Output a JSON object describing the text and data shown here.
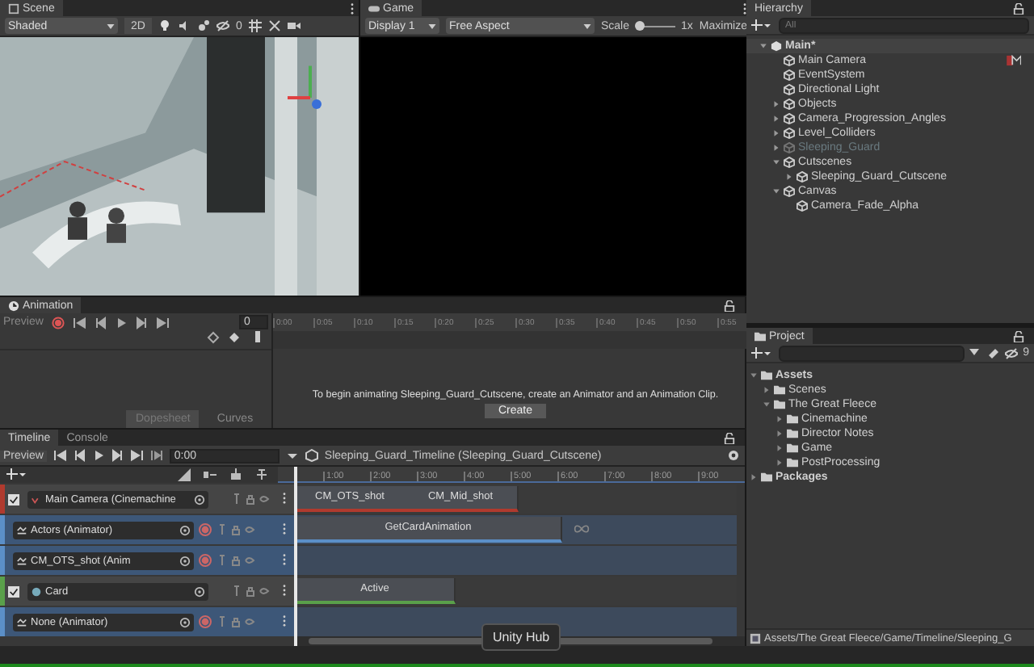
{
  "scene": {
    "tab": "Scene",
    "shading": "Shaded",
    "mode_2d": "2D",
    "hidden_count": "0"
  },
  "game": {
    "tab": "Game",
    "display": "Display 1",
    "aspect": "Free Aspect",
    "scale": {
      "label": "Scale",
      "level": 0.1,
      "reading": "1x"
    },
    "maximize": "Maximize"
  },
  "animation": {
    "tab": "Animation",
    "preview": "Preview",
    "frame": "0",
    "ticks": [
      "0:00",
      "0:05",
      "0:10",
      "0:15",
      "0:20",
      "0:25",
      "0:30",
      "0:35",
      "0:40",
      "0:45",
      "0:50",
      "0:55"
    ],
    "message": "To begin animating Sleeping_Guard_Cutscene, create an Animator and an Animation Clip.",
    "create_button": "Create",
    "views": [
      {
        "label": "Dopesheet",
        "selected": true
      },
      {
        "label": "Curves",
        "selected": false
      }
    ]
  },
  "timeline": {
    "tabs": [
      {
        "label": "Timeline",
        "selected": true
      },
      {
        "label": "Console",
        "selected": false
      }
    ],
    "preview": "Preview",
    "time": "0:00",
    "asset": "Sleeping_Guard_Timeline (Sleeping_Guard_Cutscene)",
    "ticks": [
      "1:00",
      "2:00",
      "3:00",
      "4:00",
      "5:00",
      "6:00",
      "7:00",
      "8:00",
      "9:00"
    ],
    "tracks": [
      {
        "kind": "cinemachine",
        "name": "Main Camera (Cinemachine",
        "color": "#b03a2e",
        "selected": false,
        "checked": true,
        "clips": [
          {
            "label": "CM_OTS_shot"
          },
          {
            "label": "CM_Mid_shot"
          }
        ]
      },
      {
        "kind": "animator",
        "name": "Actors (Animator)",
        "color": "#5b8fc7",
        "selected": true,
        "checked": false,
        "clips": [
          {
            "label": "GetCardAnimation"
          }
        ]
      },
      {
        "kind": "animator",
        "name": "CM_OTS_shot (Anim",
        "color": "#5b8fc7",
        "selected": true,
        "checked": false
      },
      {
        "kind": "activation",
        "name": "Card",
        "color": "#5aa04a",
        "selected": false,
        "checked": true,
        "clips": [
          {
            "label": "Active"
          }
        ]
      },
      {
        "kind": "animator",
        "name": "None (Animator)",
        "color": "#5b8fc7",
        "selected": true,
        "checked": false
      }
    ]
  },
  "hierarchy": {
    "title": "Hierarchy",
    "placeholder": "All",
    "items": [
      {
        "name": "Main*",
        "kind": "scene",
        "expanded": true,
        "disabled": false,
        "children": [
          {
            "name": "Main Camera",
            "kind": "object",
            "disabled": false
          },
          {
            "name": "EventSystem",
            "kind": "object",
            "disabled": false
          },
          {
            "name": "Directional Light",
            "kind": "object",
            "disabled": false
          },
          {
            "name": "Objects",
            "kind": "object",
            "expanded": false,
            "disabled": false
          },
          {
            "name": "Camera_Progression_Angles",
            "kind": "object",
            "expanded": false,
            "disabled": false
          },
          {
            "name": "Level_Colliders",
            "kind": "object",
            "expanded": false,
            "disabled": false
          },
          {
            "name": "Sleeping_Guard",
            "kind": "object",
            "expanded": false,
            "disabled": true
          },
          {
            "name": "Cutscenes",
            "kind": "object",
            "expanded": true,
            "disabled": false,
            "children": [
              {
                "name": "Sleeping_Guard_Cutscene",
                "kind": "object",
                "expanded": false,
                "disabled": false
              }
            ]
          },
          {
            "name": "Canvas",
            "kind": "object",
            "expanded": true,
            "disabled": false,
            "children": [
              {
                "name": "Camera_Fade_Alpha",
                "kind": "object",
                "disabled": false
              }
            ]
          }
        ]
      }
    ]
  },
  "project": {
    "title": "Project",
    "hidden_count": "9",
    "items": [
      {
        "name": "Assets",
        "expanded": true,
        "children": [
          {
            "name": "Scenes",
            "expanded": false
          },
          {
            "name": "The Great Fleece",
            "expanded": true,
            "children": [
              {
                "name": "Cinemachine",
                "expanded": false
              },
              {
                "name": "Director Notes",
                "expanded": false
              },
              {
                "name": "Game",
                "expanded": false
              },
              {
                "name": "PostProcessing",
                "expanded": false
              }
            ]
          }
        ]
      },
      {
        "name": "Packages",
        "expanded": false
      }
    ],
    "path": "Assets/The Great Fleece/Game/Timeline/Sleeping_G"
  },
  "tooltip": "Unity Hub"
}
